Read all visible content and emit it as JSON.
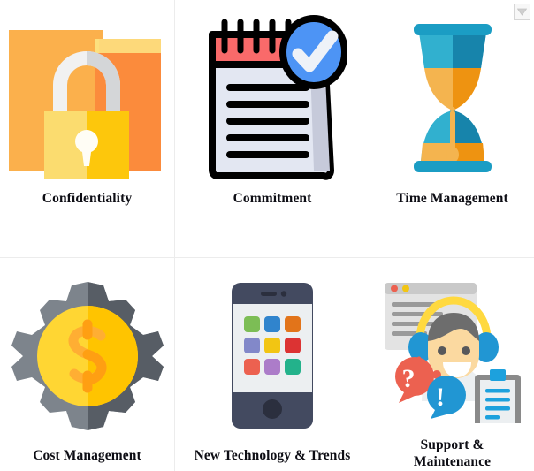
{
  "grid": {
    "columns": 3,
    "rows": 2,
    "divider_color": "#ececec",
    "background": "#ffffff",
    "cells": [
      {
        "label": "Confidentiality",
        "icon": "folder-lock-icon",
        "colors": {
          "folder_light": "#fbb04c",
          "folder_dark": "#fb8b3c",
          "tab_light": "#fdd97a",
          "tab_dark": "#fce07e",
          "shackle_light": "#f1f1f1",
          "shackle_dark": "#d4d6d8",
          "body_light": "#fbdc6f",
          "body_dark": "#fdc70c",
          "keyhole": "#fffdf5"
        }
      },
      {
        "label": "Commitment",
        "icon": "notepad-check-icon",
        "colors": {
          "outline": "#000000",
          "header_red": "#f96a6a",
          "paper": "#e3e7f2",
          "paper_shadow": "#c6cada",
          "badge_blue": "#4d94f5",
          "check_white": "#eef2f8"
        }
      },
      {
        "label": "Time Management",
        "icon": "hourglass-icon",
        "colors": {
          "rim": "#1b9dc4",
          "glass_light": "#31b0cf",
          "glass_dark": "#1784ab",
          "sand_light": "#f4b44f",
          "sand_dark": "#ee9311"
        }
      },
      {
        "label": "Cost Management",
        "icon": "gear-coin-dollar-icon",
        "colors": {
          "gear_light": "#7d848c",
          "gear_dark": "#575d65",
          "coin_light": "#ffd633",
          "coin_dark": "#ffc400",
          "dollar_light": "#ffae33",
          "dollar_dark": "#ff9f12"
        }
      },
      {
        "label": "New Technology & Trends",
        "icon": "smartphone-apps-icon",
        "colors": {
          "body": "#434a60",
          "screen": "#eceff1",
          "home_button": "#2b2f3e",
          "speaker": "#2b2f3e"
        },
        "app_colors": [
          "#7cb champs",
          "#7cbd55",
          "#3084cd",
          "#e2741a",
          "#8288c9",
          "#f2c513",
          "#dc3333",
          "#ec6150",
          "#ac7cc9",
          "#23b28b"
        ]
      },
      {
        "label": "Support & Maintenance",
        "label_lines": [
          "Support &",
          "Maintenance"
        ],
        "icon": "support-agent-icon",
        "colors": {
          "window_bg": "#e3e3e3",
          "window_bar": "#c9c9c9",
          "dot_red": "#ec6150",
          "dot_yellow": "#f2c513",
          "text_line": "#9a9a9a",
          "headset": "#ffd93f",
          "ear_blue": "#2196d3",
          "hair": "#6d6d6d",
          "skin": "#fbd9a0",
          "shirt": "#eceff1",
          "tie": "#2fd7ac",
          "bubble_orange": "#ec6150",
          "bubble_blue": "#2196d3",
          "clipboard_frame": "#8a8a8a",
          "clipboard_line": "#1da1dd"
        }
      }
    ]
  },
  "dropdown_control": {
    "name": "dropdown-toggle",
    "icon": "chevron-down-icon",
    "border_color": "#d6d6d6",
    "fill_color": "#f7f7f7",
    "arrow_color": "#cfcfcf"
  }
}
